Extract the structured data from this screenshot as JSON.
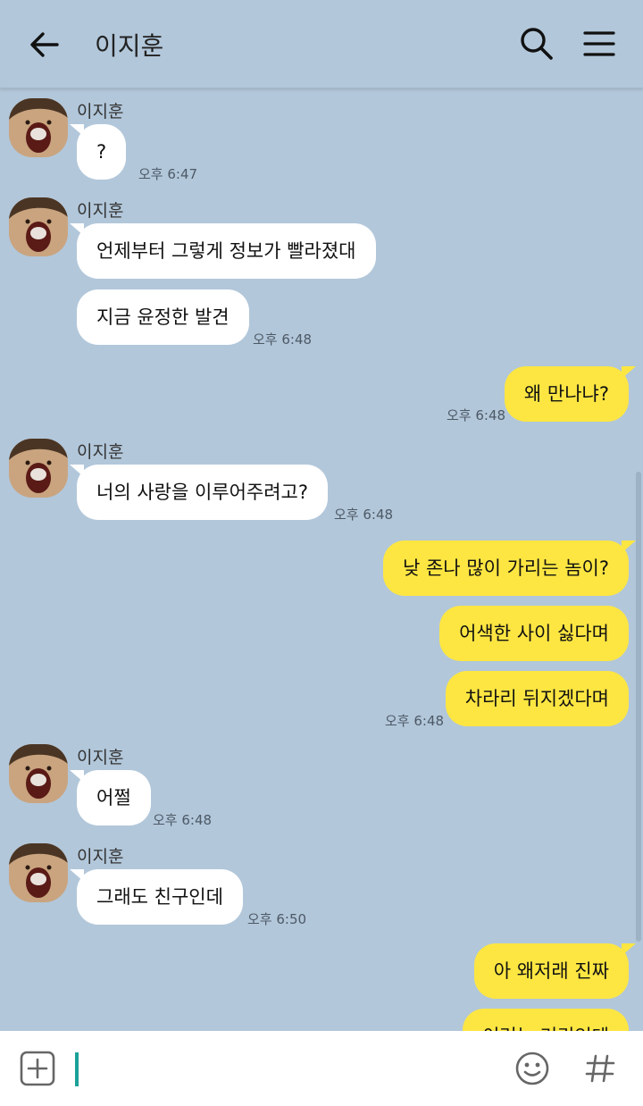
{
  "header": {
    "title": "이지훈",
    "back_icon": "arrow-left-icon",
    "search_icon": "search-icon",
    "menu_icon": "hamburger-menu-icon"
  },
  "messages": [
    {
      "sender": "이지훈",
      "text": "?",
      "time": "오후 6:47"
    },
    {
      "sender": "이지훈",
      "text": "언제부터 그렇게 정보가 빨라졌대"
    },
    {
      "text": "지금 윤정한 발견",
      "time": "오후 6:48"
    },
    {
      "text": "왜 만나냐?",
      "time": "오후 6:48"
    },
    {
      "sender": "이지훈",
      "text": "너의 사랑을 이루어주려고?",
      "time": "오후 6:48"
    },
    {
      "text": "낮 존나 많이 가리는 놈이?"
    },
    {
      "text": "어색한 사이 싫다며"
    },
    {
      "text": "차라리 뒤지겠다며",
      "time": "오후 6:48"
    },
    {
      "sender": "이지훈",
      "text": "어쩔",
      "time": "오후 6:48"
    },
    {
      "sender": "이지훈",
      "text": "그래도 친구인데",
      "time": "오후 6:50"
    },
    {
      "text": "아 왜저래 진짜"
    },
    {
      "text": "이러는 거리인데"
    }
  ],
  "input": {
    "value": "",
    "attach_icon": "plus-square-icon",
    "emoji_icon": "smiley-icon",
    "hashtag_icon": "hashtag-icon"
  },
  "colors": {
    "background": "#b2c7da",
    "incoming_bubble": "#ffffff",
    "outgoing_bubble": "#fde642",
    "cursor": "#1aa198"
  }
}
